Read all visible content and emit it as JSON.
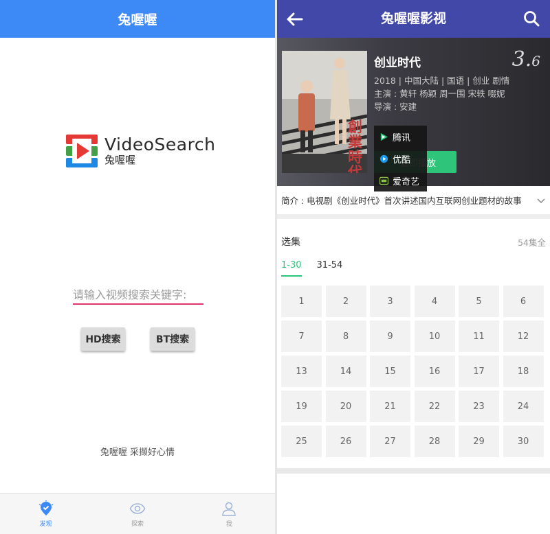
{
  "left": {
    "header_title": "兔喔喔",
    "logo": {
      "title": "VideoSearch",
      "subtitle": "兔喔喔"
    },
    "search": {
      "placeholder": "请输入视频搜索关键字:",
      "value": ""
    },
    "buttons": {
      "hd": "HD搜索",
      "bt": "BT搜索"
    },
    "slogan": "兔喔喔 采撷好心情",
    "tabs": [
      {
        "label": "发现",
        "icon": "discover-icon",
        "active": true
      },
      {
        "label": "探索",
        "icon": "eye-icon",
        "active": false
      },
      {
        "label": "我",
        "icon": "user-icon",
        "active": false
      }
    ],
    "accent_color": "#3d8af7"
  },
  "right": {
    "header_title": "兔喔喔影视",
    "header_color": "#4248a8",
    "movie": {
      "title": "创业时代",
      "rating_int": "3.",
      "rating_dec": "6",
      "info": "2018 | 中国大陆 | 国语 | 创业 剧情",
      "cast": "主演 : 黄轩  杨颖  周一围  宋轶  啜妮",
      "director": "导演 : 安建",
      "play_label": "立即播放",
      "poster_text": "創業時代"
    },
    "sources": [
      {
        "label": "腾讯",
        "icon": "tencent-video-icon"
      },
      {
        "label": "优酷",
        "icon": "youku-icon"
      },
      {
        "label": "爱奇艺",
        "icon": "iqiyi-icon"
      }
    ],
    "intro": "简介 : 电视剧《创业时代》首次讲述国内互联网创业题材的故事",
    "episodes": {
      "title": "选集",
      "count": "54集全",
      "ranges": [
        "1-30",
        "31-54"
      ],
      "active_range": 0,
      "list": [
        "1",
        "2",
        "3",
        "4",
        "5",
        "6",
        "7",
        "8",
        "9",
        "10",
        "11",
        "12",
        "13",
        "14",
        "15",
        "16",
        "17",
        "18",
        "19",
        "20",
        "21",
        "22",
        "23",
        "24",
        "25",
        "26",
        "27",
        "28",
        "29",
        "30"
      ]
    },
    "accent_color": "#2ec57a"
  }
}
